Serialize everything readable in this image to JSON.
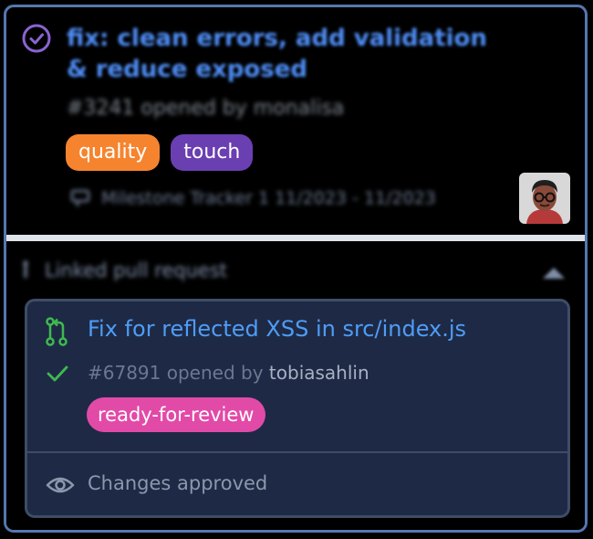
{
  "issue": {
    "title": "fix: clean errors, add validation & reduce exposed",
    "meta": "#3241 opened by monalisa",
    "labels": [
      {
        "name": "quality",
        "color": "#f6842e"
      },
      {
        "name": "touch",
        "color": "#6a3fb1"
      }
    ],
    "milestone": "Milestone Tracker 1 11/2023 - 11/2023",
    "status_color": "#8a63d2"
  },
  "linked": {
    "header": "Linked pull request",
    "pull_request": {
      "title": "Fix for reflected XSS in src/index.js",
      "number": "#67891",
      "opened_by_text": "opened by",
      "author": "tobiasahlin",
      "label": "ready-for-review",
      "label_color": "#e24aa8",
      "review_status": "Changes approved",
      "accent_color": "#3fb950"
    }
  }
}
